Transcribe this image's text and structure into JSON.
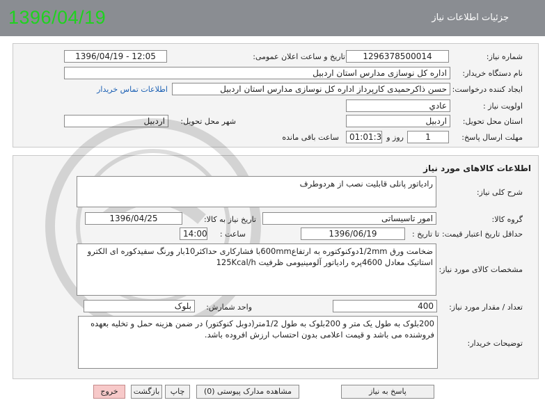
{
  "header": {
    "date": "1396/04/19",
    "title": "جزئیات اطلاعات نیاز"
  },
  "need_info": {
    "need_number_label": "شماره نیاز:",
    "need_number": "1296378500014",
    "announce_label": "تاریخ و ساعت اعلان عمومی:",
    "announce_value": "1396/04/19 - 12:05",
    "buyer_org_label": "نام دستگاه خریدار:",
    "buyer_org": "اداره کل نوسازی مدارس استان اردبیل",
    "creator_label": "ایجاد کننده درخواست:",
    "creator": "حسن ذاکرحمیدی کارپرداز اداره کل نوسازی مدارس استان اردبیل",
    "contact_link": "اطلاعات تماس خریدار",
    "priority_label": "اولویت نیاز :",
    "priority": "عادي",
    "province_label": "استان محل تحویل:",
    "province": "اردبیل",
    "city_label": "شهر محل تحویل:",
    "city": "اردبیل",
    "deadline_label": "مهلت ارسال پاسخ:",
    "days": "1",
    "days_and": "روز و",
    "time_left": "01:01:37",
    "time_left_label": "ساعت باقی مانده"
  },
  "goods": {
    "section_title": "اطلاعات کالاهای مورد نیاز",
    "summary_label": "شرح کلی نیاز:",
    "summary": "رادیاتور پانلی قابلیت نصب از هردوطرف",
    "group_label": "گروه کالا:",
    "group": "امور تاسیساتی",
    "need_date_label": "تاریخ نیاز به کالا:",
    "need_date": "1396/04/25",
    "validity_label": "حداقل تاریخ اعتبار قیمت:",
    "to_date_label": "تا تاریخ :",
    "to_date": "1396/06/19",
    "hour_label": "ساعت :",
    "hour": "14:00",
    "specs_label": "مشخصات کالای مورد نیاز:",
    "specs": "ضخامت ورق 1/2mmدوکنوکتوره به ارتفاع600mmبا فشارکاری حداکثر10بار ورنگ سفیدکوره ای الکترو استاتیک معادل 4600پره رادیاتور آلومینیومی ظرفیت 125Kcal/h",
    "qty_label": "تعداد / مقدار مورد نیاز:",
    "qty": "400",
    "unit_label": "واحد شمارش:",
    "unit": "بلوک",
    "buyer_notes_label": "توضیحات خریدار:",
    "buyer_notes": "200بلوک به طول یک متر و 200بلوک به طول 1/2متر(دوبل کنوکتور) در ضمن هزینه حمل و تخلیه بعهده فروشنده می باشد و قیمت اعلامی بدون احتساب ارزش افروده باشد."
  },
  "buttons": {
    "reply": "پاسخ به نیاز",
    "attachments": "مشاهده مدارک پیوستی (0)",
    "print": "چاپ",
    "back": "بازگشت",
    "exit": "خروج"
  }
}
